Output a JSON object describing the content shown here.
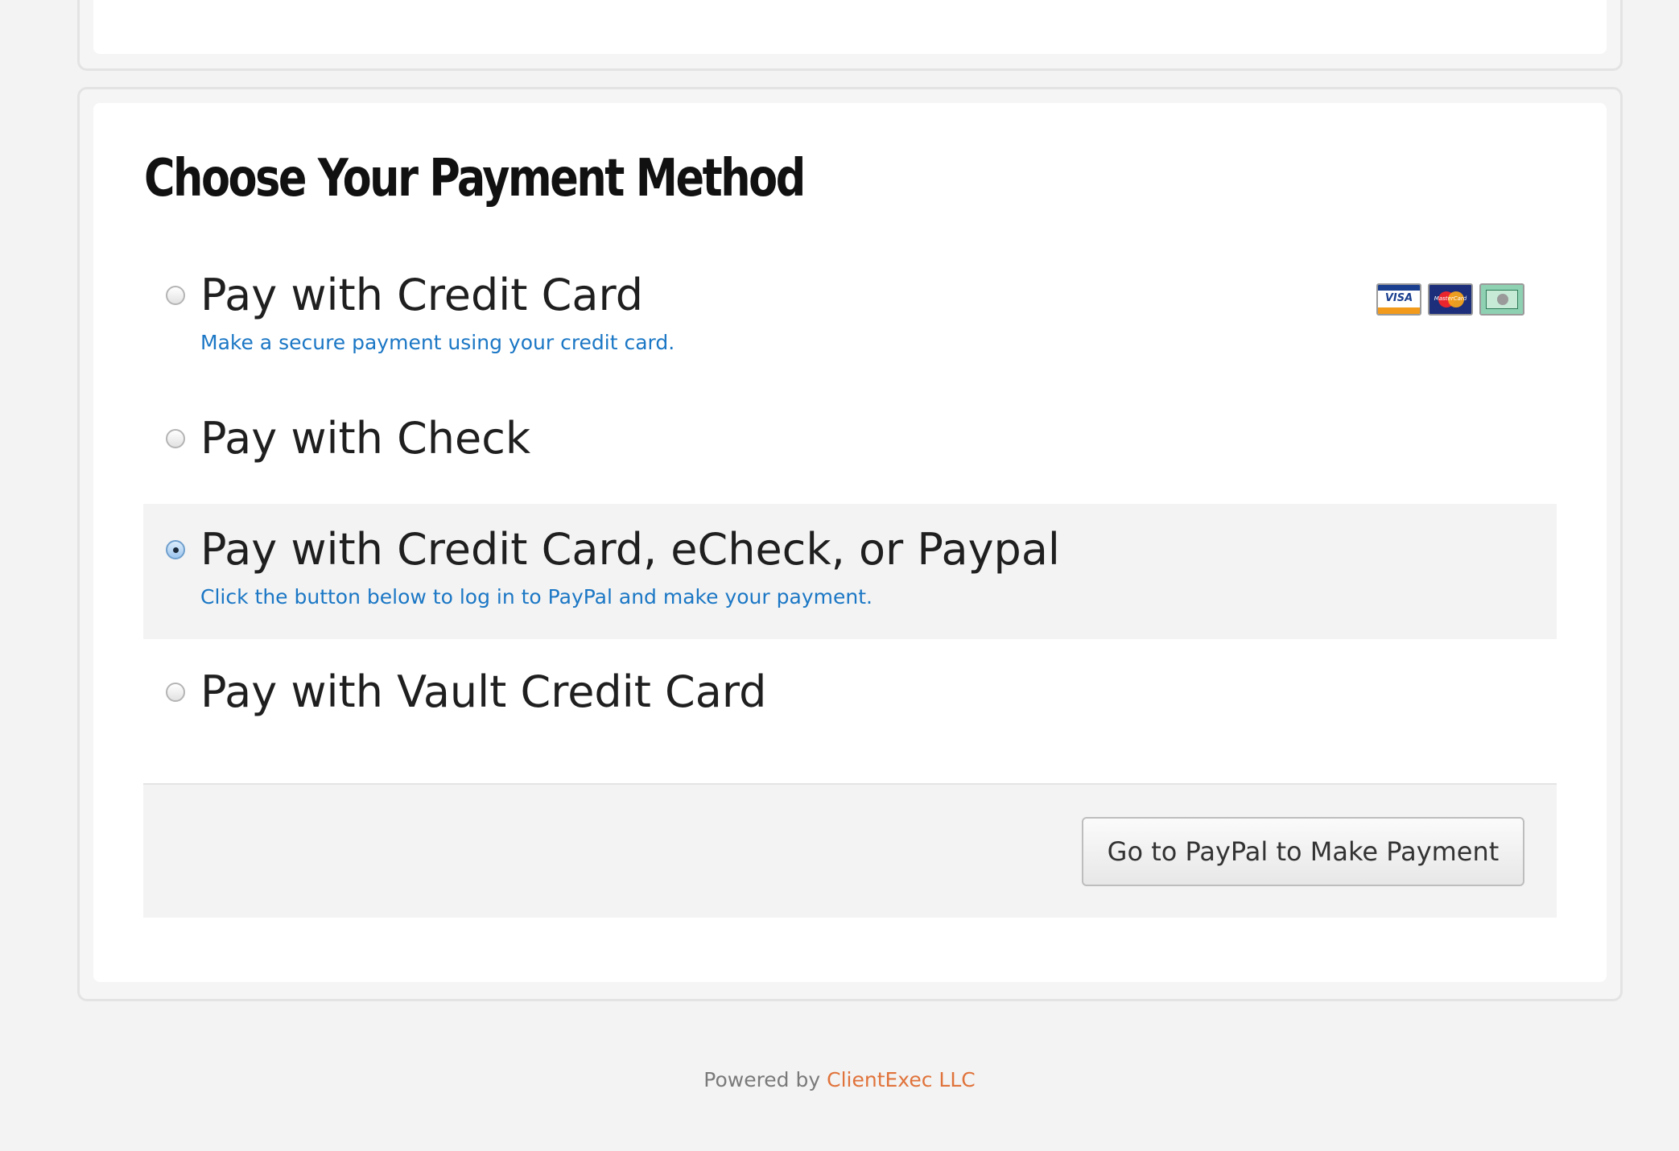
{
  "payment": {
    "title": "Choose Your Payment Method",
    "options": [
      {
        "label": "Pay with Credit Card",
        "description": "Make a secure payment using your credit card.",
        "selected": false,
        "card_icons": [
          "visa-card-icon",
          "mastercard-icon",
          "amex-card-icon"
        ]
      },
      {
        "label": "Pay with Check",
        "selected": false
      },
      {
        "label": "Pay with Credit Card, eCheck, or Paypal",
        "description": "Click the button below to log in to PayPal and make your payment.",
        "selected": true
      },
      {
        "label": "Pay with Vault Credit Card",
        "selected": false
      }
    ],
    "submit_label": "Go to PayPal to Make Payment"
  },
  "footer": {
    "prefix": "Powered by",
    "company": "ClientExec LLC"
  },
  "colors": {
    "page_background": "#f3f3f3",
    "description_text": "#1b77c5",
    "footer_link": "#e0733b",
    "selected_row": "#f3f3f3"
  }
}
